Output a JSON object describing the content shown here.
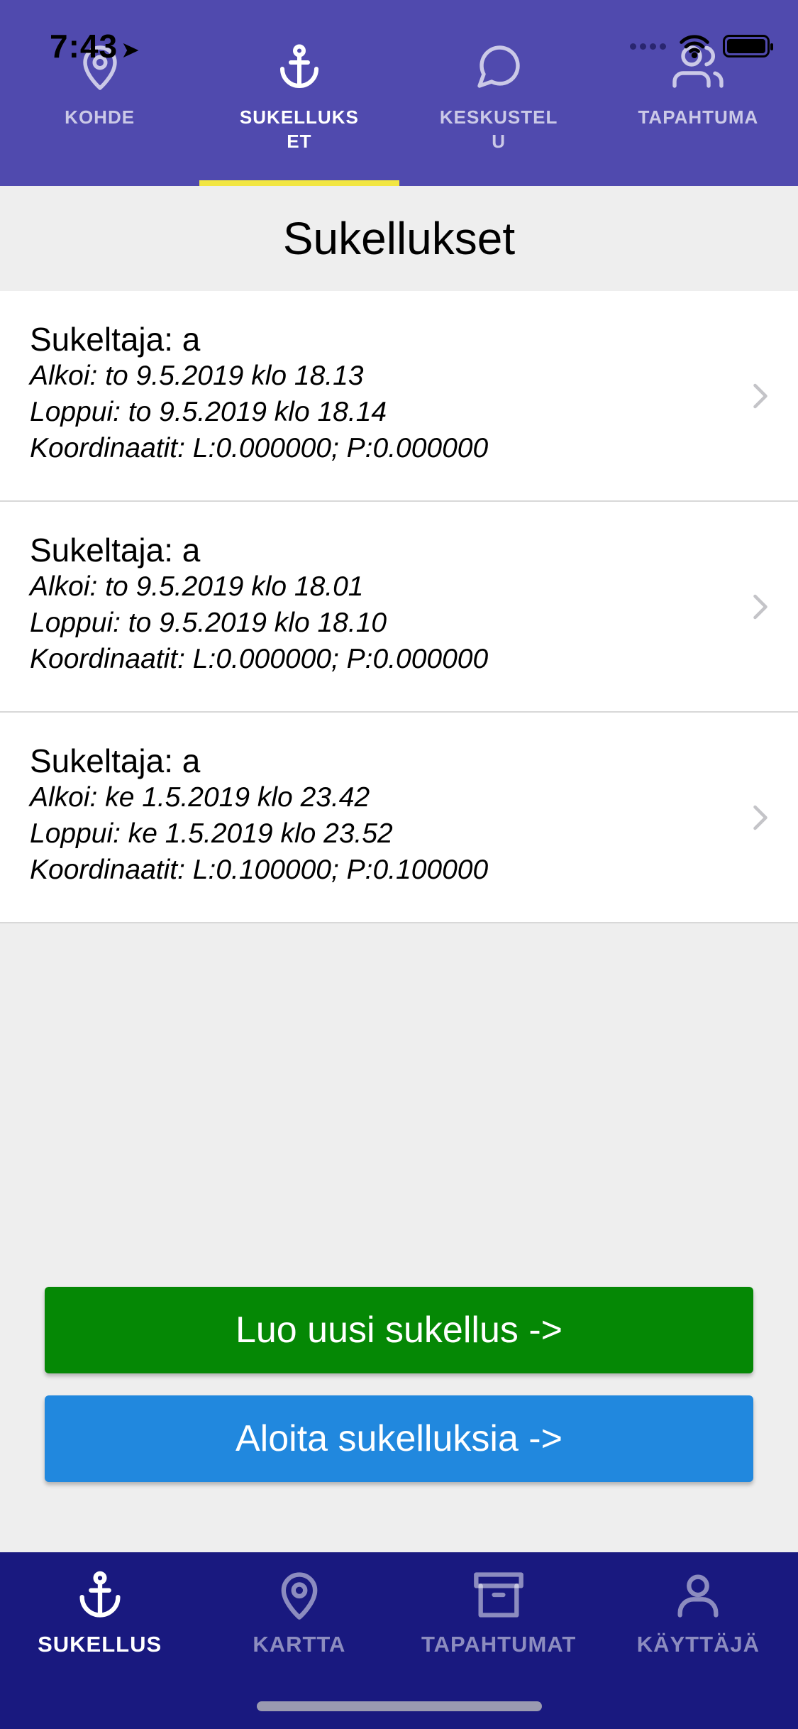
{
  "status": {
    "time": "7:43"
  },
  "top_tabs": [
    {
      "label": "KOHDE",
      "icon": "location-pin-icon",
      "active": false
    },
    {
      "label": "SUKELLUKSET",
      "icon": "anchor-icon",
      "active": true
    },
    {
      "label": "KESKUSTELU",
      "icon": "chat-bubble-icon",
      "active": false
    },
    {
      "label": "TAPAHTUMA",
      "icon": "users-icon",
      "active": false
    }
  ],
  "page": {
    "title": "Sukellukset"
  },
  "dives": [
    {
      "diver": "Sukeltaja: a",
      "started": "Alkoi: to 9.5.2019 klo 18.13",
      "ended": "Loppui: to 9.5.2019 klo 18.14",
      "coordinates": "Koordinaatit: L:0.000000; P:0.000000"
    },
    {
      "diver": "Sukeltaja: a",
      "started": "Alkoi: to 9.5.2019 klo 18.01",
      "ended": "Loppui: to 9.5.2019 klo 18.10",
      "coordinates": "Koordinaatit: L:0.000000; P:0.000000"
    },
    {
      "diver": "Sukeltaja: a",
      "started": "Alkoi: ke 1.5.2019 klo 23.42",
      "ended": "Loppui: ke 1.5.2019 klo 23.52",
      "coordinates": "Koordinaatit: L:0.100000; P:0.100000"
    }
  ],
  "buttons": {
    "create": "Luo uusi sukellus ->",
    "start": "Aloita sukelluksia ->"
  },
  "bottom_tabs": [
    {
      "label": "SUKELLUS",
      "icon": "anchor-icon",
      "active": true
    },
    {
      "label": "KARTTA",
      "icon": "location-pin-icon",
      "active": false
    },
    {
      "label": "TAPAHTUMAT",
      "icon": "archive-box-icon",
      "active": false
    },
    {
      "label": "KÄYTTÄJÄ",
      "icon": "user-icon",
      "active": false
    }
  ],
  "colors": {
    "top_bar": "#504aae",
    "tab_indicator": "#f2e642",
    "create_button": "#058805",
    "start_button": "#2188de",
    "bottom_bar": "#19197f"
  }
}
